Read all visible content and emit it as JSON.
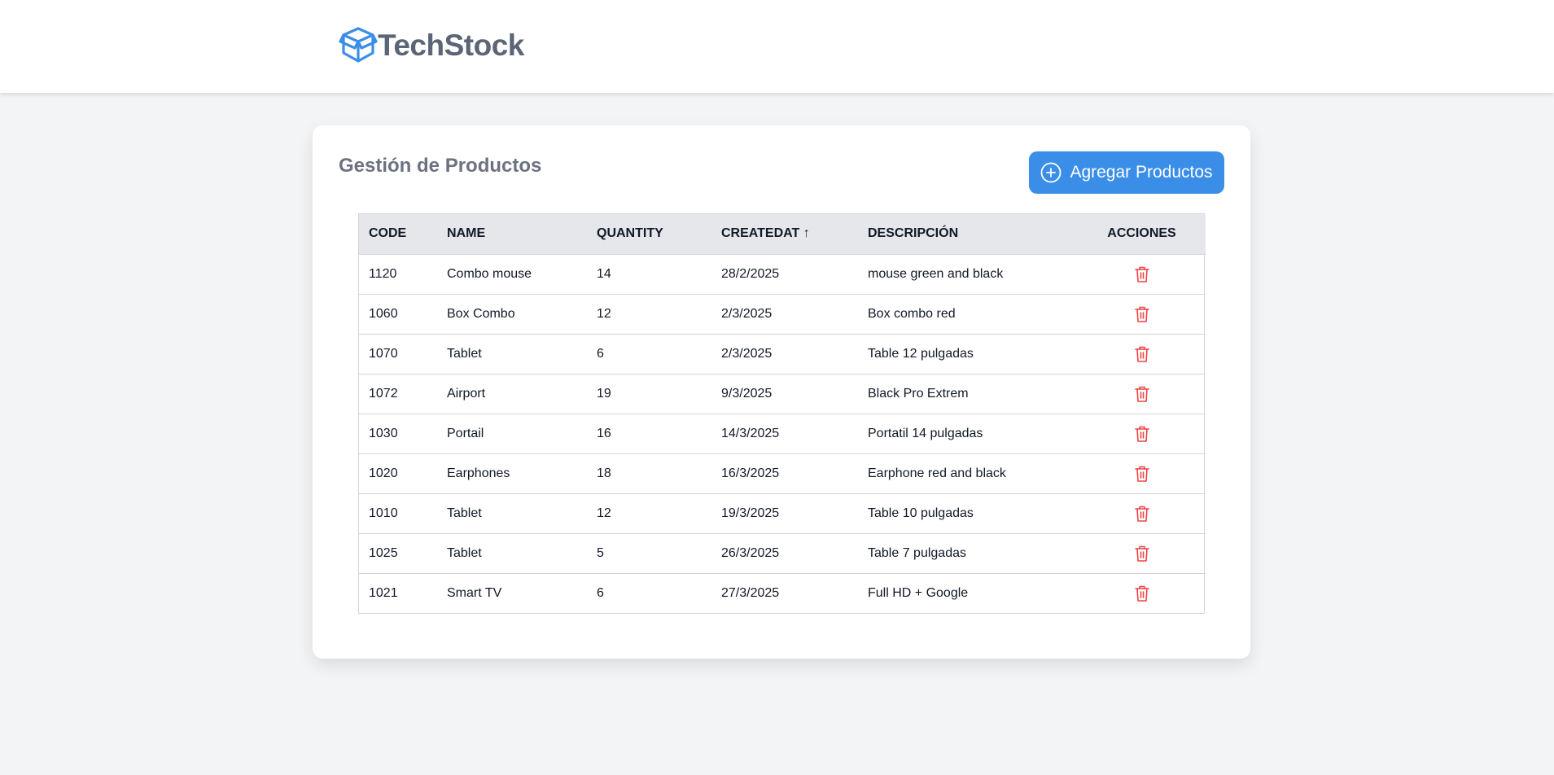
{
  "brand": {
    "name": "TechStock",
    "icon": "package-box-icon",
    "icon_color": "#3b8ee8"
  },
  "page": {
    "title": "Gestión de Productos",
    "add_button_label": "Agregar Productos",
    "add_button_icon": "plus-circle-icon",
    "accent_color": "#3b8ee8"
  },
  "table": {
    "headers": {
      "code": "CODE",
      "name": "NAME",
      "quantity": "QUANTITY",
      "createdat": "CREATEDAT ↑",
      "description": "DESCRIPCIÓN",
      "actions": "ACCIONES"
    },
    "delete_icon": "trash-icon",
    "delete_color": "#ef4444",
    "rows": [
      {
        "code": "1120",
        "name": "Combo mouse",
        "quantity": "14",
        "createdat": "28/2/2025",
        "description": "mouse green and black"
      },
      {
        "code": "1060",
        "name": "Box Combo",
        "quantity": "12",
        "createdat": "2/3/2025",
        "description": "Box combo red"
      },
      {
        "code": "1070",
        "name": "Tablet",
        "quantity": "6",
        "createdat": "2/3/2025",
        "description": "Table 12 pulgadas"
      },
      {
        "code": "1072",
        "name": "Airport",
        "quantity": "19",
        "createdat": "9/3/2025",
        "description": "Black Pro Extrem"
      },
      {
        "code": "1030",
        "name": "Portail",
        "quantity": "16",
        "createdat": "14/3/2025",
        "description": "Portatil 14 pulgadas"
      },
      {
        "code": "1020",
        "name": "Earphones",
        "quantity": "18",
        "createdat": "16/3/2025",
        "description": "Earphone red and black"
      },
      {
        "code": "1010",
        "name": "Tablet",
        "quantity": "12",
        "createdat": "19/3/2025",
        "description": "Table 10 pulgadas"
      },
      {
        "code": "1025",
        "name": "Tablet",
        "quantity": "5",
        "createdat": "26/3/2025",
        "description": "Table 7 pulgadas"
      },
      {
        "code": "1021",
        "name": "Smart TV",
        "quantity": "6",
        "createdat": "27/3/2025",
        "description": "Full HD + Google"
      }
    ]
  }
}
